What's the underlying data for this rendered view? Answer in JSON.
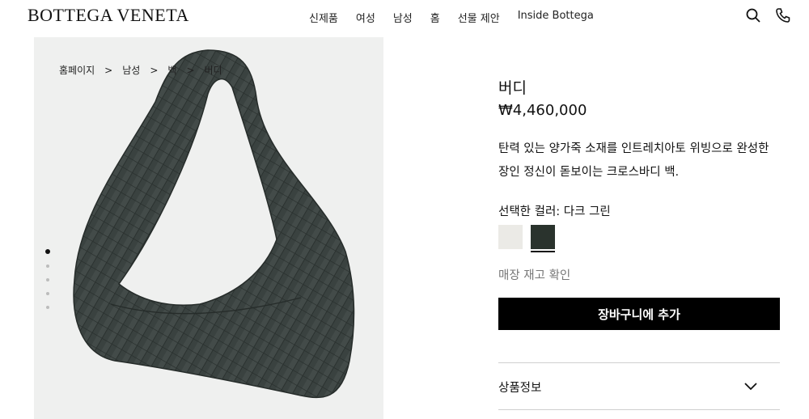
{
  "header": {
    "brand": "BOTTEGA VENETA",
    "nav": [
      "신제품",
      "여성",
      "남성",
      "홈",
      "선물 제안",
      "Inside Bottega"
    ],
    "icons": [
      "search-icon",
      "phone-icon"
    ]
  },
  "breadcrumb": [
    "홈페이지",
    "남성",
    "백",
    "버디"
  ],
  "gallery": {
    "total": 5,
    "active": 1
  },
  "product": {
    "name": "버디",
    "price": "₩4,460,000",
    "description": "탄력 있는 양가죽 소재를 인트레치아토 위빙으로 완성한 장인 정신이 돋보이는 크로스바디 백.",
    "color_label": "선택한 컬러: 다크 그린",
    "colors": [
      {
        "name": "white",
        "hex": "#ebeae6"
      },
      {
        "name": "dark-green",
        "hex": "#2a332d",
        "selected": true
      }
    ],
    "stock_check": "매장 재고 확인",
    "add_to_cart": "장바구니에 추가"
  },
  "accordion": {
    "title": "상품정보",
    "icon": "chevron-down-icon"
  },
  "colors": {
    "panel_bg": "#eff0ef",
    "bag": "#3a4240",
    "button": "#000000"
  }
}
